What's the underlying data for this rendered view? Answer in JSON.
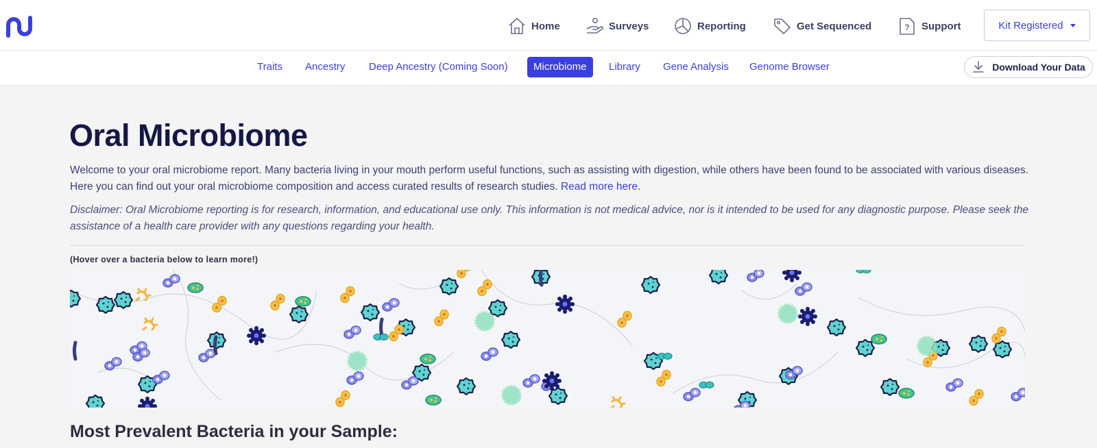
{
  "header": {
    "nav": [
      {
        "label": "Home",
        "icon": "home-icon"
      },
      {
        "label": "Surveys",
        "icon": "hand-icon"
      },
      {
        "label": "Reporting",
        "icon": "pie-chart-icon"
      },
      {
        "label": "Get Sequenced",
        "icon": "tag-icon"
      },
      {
        "label": "Support",
        "icon": "help-icon"
      }
    ],
    "kit_label": "Kit Registered"
  },
  "subnav": {
    "tabs": [
      {
        "label": "Traits",
        "active": false
      },
      {
        "label": "Ancestry",
        "active": false
      },
      {
        "label": "Deep Ancestry (Coming Soon)",
        "active": false
      },
      {
        "label": "Microbiome",
        "active": true
      },
      {
        "label": "Library",
        "active": false
      },
      {
        "label": "Gene Analysis",
        "active": false
      },
      {
        "label": "Genome Browser",
        "active": false
      }
    ],
    "download_label": "Download Your Data"
  },
  "main": {
    "title": "Oral Microbiome",
    "intro": "Welcome to your oral microbiome report. Many bacteria living in your mouth perform useful functions, such as assisting with digestion, while others have been found to be associated with various diseases. Here you can find out your oral microbiome composition and access curated results of research studies.",
    "read_more": "Read more here",
    "disclaimer": "Disclaimer: Oral Microbiome reporting is for research, information, and educational use only. This information is not medical advice, nor is it intended to be used for any diagnostic purpose. Please seek the assistance of a health care provider with any questions regarding your health.",
    "hover_hint": "(Hover over a bacteria below to learn more!)",
    "section_title": "Most Prevalent Bacteria in your Sample:"
  },
  "colors": {
    "accent": "#3b3fe0",
    "title": "#141845",
    "teal_bacteria": "#5fd3d0",
    "blue_bacteria": "#8d8ee6",
    "yellow_bacteria": "#f6c543",
    "green_bacteria": "#45c494",
    "navy_bacteria": "#1a1c6e"
  }
}
